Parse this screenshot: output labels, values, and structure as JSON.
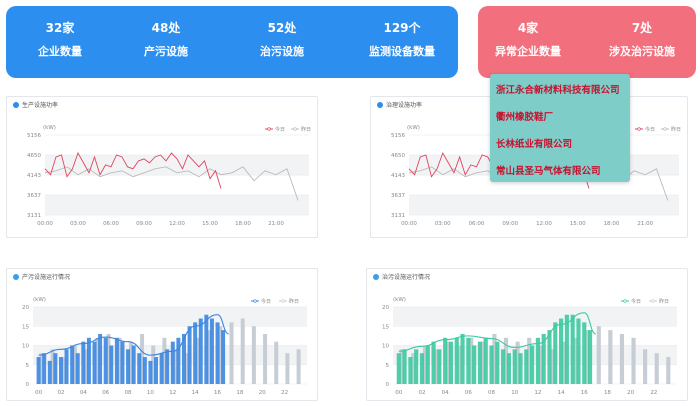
{
  "summary": {
    "items": [
      {
        "value": "32家",
        "label": "企业数量"
      },
      {
        "value": "48处",
        "label": "产污设施"
      },
      {
        "value": "52处",
        "label": "治污设施"
      },
      {
        "value": "129个",
        "label": "监测设备数量"
      }
    ]
  },
  "alerts": {
    "items": [
      {
        "value": "4家",
        "label": "异常企业数量"
      },
      {
        "value": "7处",
        "label": "涉及治污设施"
      }
    ],
    "dropdown": [
      "浙江永合新材料科技有限公司",
      "衢州橡胶鞋厂",
      "长林纸业有限公司",
      "常山县圣马气体有限公司"
    ]
  },
  "colors": {
    "blue": "#2c8ff0",
    "red": "#f2707d",
    "teal": "#7fcdc8",
    "pink": "#e0455f",
    "green": "#3cc9a0"
  },
  "chart_data": [
    {
      "type": "line",
      "title": "生产设施功率",
      "ylabel": "(kW)",
      "yticks": [
        5156,
        4650,
        4143,
        3637,
        3131
      ],
      "ylim": [
        3131,
        5156
      ],
      "xticks": [
        "00:00",
        "03:00",
        "06:00",
        "09:00",
        "12:00",
        "15:00",
        "18:00",
        "21:00"
      ],
      "xlim": [
        0,
        24
      ],
      "series": [
        {
          "name": "今日",
          "color": "#e0455f",
          "x": [
            0,
            0.5,
            1,
            1.5,
            2,
            2.5,
            3,
            3.5,
            4,
            4.5,
            5,
            5.5,
            6,
            6.5,
            7,
            7.5,
            8,
            8.5,
            9,
            9.5,
            10,
            10.5,
            11,
            11.5,
            12,
            12.5,
            13,
            13.5,
            14,
            14.5,
            15,
            15.5,
            16
          ],
          "y": [
            4300,
            4150,
            4600,
            4650,
            4100,
            4300,
            4700,
            4450,
            4200,
            4600,
            4150,
            4400,
            4350,
            4650,
            4600,
            4350,
            4300,
            4500,
            4550,
            4450,
            4600,
            4650,
            4500,
            4700,
            4550,
            4300,
            4650,
            4500,
            4350,
            4500,
            4050,
            4250,
            3800
          ]
        },
        {
          "name": "昨日",
          "color": "#bbbbbb",
          "x": [
            0,
            1,
            2,
            3,
            4,
            5,
            6,
            7,
            8,
            9,
            10,
            11,
            12,
            13,
            14,
            15,
            16,
            17,
            18,
            19,
            20,
            21,
            22,
            23
          ],
          "y": [
            4200,
            4250,
            4350,
            4150,
            4300,
            4100,
            4200,
            4250,
            4100,
            4200,
            4300,
            4350,
            4200,
            4250,
            4100,
            4300,
            4150,
            4200,
            4350,
            4000,
            4250,
            4150,
            4300,
            3500
          ]
        }
      ]
    },
    {
      "type": "line",
      "title": "治理设施功率",
      "ylabel": "(kW)",
      "yticks": [
        5156,
        4650,
        4143,
        3637,
        3131
      ],
      "ylim": [
        3131,
        5156
      ],
      "xticks": [
        "00:00",
        "03:00",
        "06:00",
        "09:00",
        "12:00",
        "15:00",
        "18:00",
        "21:00"
      ],
      "xlim": [
        0,
        24
      ],
      "series": [
        {
          "name": "今日",
          "color": "#e0455f",
          "x": [
            0,
            0.5,
            1,
            1.5,
            2,
            2.5,
            3,
            3.5,
            4,
            4.5,
            5,
            5.5,
            6,
            6.5,
            7,
            7.5,
            8,
            8.5,
            9,
            9.5,
            10,
            10.5,
            11,
            11.5,
            12,
            12.5,
            13,
            13.5,
            14,
            14.5,
            15,
            15.5,
            16
          ],
          "y": [
            4300,
            4150,
            4600,
            4650,
            4100,
            4300,
            4700,
            4450,
            4200,
            4600,
            4150,
            4400,
            4350,
            4650,
            4600,
            4350,
            4300,
            4500,
            4550,
            4450,
            4600,
            4650,
            4500,
            4700,
            4550,
            4300,
            4650,
            4500,
            4350,
            4500,
            4050,
            4250,
            3800
          ]
        },
        {
          "name": "昨日",
          "color": "#bbbbbb",
          "x": [
            0,
            1,
            2,
            3,
            4,
            5,
            6,
            7,
            8,
            9,
            10,
            11,
            12,
            13,
            14,
            15,
            16,
            17,
            18,
            19,
            20,
            21,
            22,
            23
          ],
          "y": [
            4200,
            4250,
            4350,
            4150,
            4300,
            4100,
            4200,
            4250,
            4100,
            4200,
            4300,
            4350,
            4200,
            4250,
            4100,
            4300,
            4150,
            4200,
            4350,
            4000,
            4250,
            4150,
            4300,
            3500
          ]
        }
      ]
    },
    {
      "type": "bar",
      "title": "产污设施运行情况",
      "ylabel": "(kW)",
      "yticks": [
        0,
        5,
        10,
        15,
        20
      ],
      "ylim": [
        0,
        20
      ],
      "xticks": [
        "00",
        "02",
        "04",
        "06",
        "08",
        "10",
        "12",
        "14",
        "16",
        "18",
        "20",
        "22"
      ],
      "series": [
        {
          "name": "今日",
          "color": "#3a86e0",
          "x": [
            0,
            0.5,
            1,
            1.5,
            2,
            2.5,
            3,
            3.5,
            4,
            4.5,
            5,
            5.5,
            6,
            6.5,
            7,
            7.5,
            8,
            8.5,
            9,
            9.5,
            10,
            10.5,
            11,
            11.5,
            12,
            12.5,
            13,
            13.5,
            14,
            14.5,
            15,
            15.5,
            16,
            16.5
          ],
          "y": [
            7,
            8,
            6,
            8,
            7,
            9,
            10,
            8,
            11,
            12,
            11,
            13,
            12,
            10,
            12,
            11,
            9,
            10,
            8,
            7,
            6,
            7,
            8,
            9,
            11,
            12,
            13,
            15,
            16,
            17,
            18,
            17,
            16,
            14
          ]
        },
        {
          "name": "昨日",
          "color": "#c7cdd5",
          "x": [
            0.25,
            1.25,
            2.25,
            3.25,
            4.25,
            5.25,
            6.25,
            7.25,
            8.25,
            9.25,
            10.25,
            11.25,
            12.25,
            13.25,
            14.25,
            15.25,
            16.25,
            17.25,
            18.25,
            19.25,
            20.25,
            21.25,
            22.25,
            23.25
          ],
          "y": [
            8,
            9,
            7,
            10,
            9,
            12,
            13,
            12,
            11,
            13,
            10,
            12,
            9,
            8,
            12,
            14,
            15,
            16,
            17,
            15,
            13,
            11,
            8,
            9
          ]
        }
      ],
      "trend": {
        "x": [
          0,
          2,
          4,
          6,
          8,
          10,
          12,
          14,
          16,
          17
        ],
        "y": [
          7.5,
          9,
          10.5,
          12.2,
          11,
          7.5,
          8.5,
          15,
          18,
          13
        ]
      }
    },
    {
      "type": "bar",
      "title": "治污设施运行情况",
      "ylabel": "(kW)",
      "yticks": [
        0,
        5,
        10,
        15,
        20
      ],
      "ylim": [
        0,
        20
      ],
      "xticks": [
        "00",
        "02",
        "04",
        "06",
        "08",
        "10",
        "12",
        "14",
        "16",
        "18",
        "20",
        "22"
      ],
      "series": [
        {
          "name": "今日",
          "color": "#3cc9a0",
          "x": [
            0,
            0.5,
            1,
            1.5,
            2,
            2.5,
            3,
            3.5,
            4,
            4.5,
            5,
            5.5,
            6,
            6.5,
            7,
            7.5,
            8,
            8.5,
            9,
            9.5,
            10,
            10.5,
            11,
            11.5,
            12,
            12.5,
            13,
            13.5,
            14,
            14.5,
            15,
            15.5,
            16,
            16.5
          ],
          "y": [
            8,
            9,
            7,
            9,
            8,
            10,
            11,
            9,
            12,
            11,
            12,
            13,
            12,
            10,
            11,
            12,
            10,
            11,
            9,
            8,
            9,
            8,
            9,
            10,
            12,
            13,
            14,
            16,
            17,
            18,
            18,
            17,
            16,
            14
          ]
        },
        {
          "name": "昨日",
          "color": "#c7cdd5",
          "x": [
            0.25,
            1.25,
            2.25,
            3.25,
            4.25,
            5.25,
            6.25,
            7.25,
            8.25,
            9.25,
            10.25,
            11.25,
            12.25,
            13.25,
            14.25,
            15.25,
            16.25,
            17.25,
            18.25,
            19.25,
            20.25,
            21.25,
            22.25,
            23.25
          ],
          "y": [
            9,
            8,
            10,
            9,
            11,
            10,
            12,
            11,
            13,
            12,
            11,
            12,
            10,
            9,
            11,
            12,
            14,
            15,
            14,
            13,
            12,
            9,
            8,
            7
          ]
        }
      ],
      "trend": {
        "x": [
          0,
          2,
          4,
          6,
          8,
          10,
          12,
          14,
          16,
          17
        ],
        "y": [
          8.5,
          9.8,
          11.5,
          12.5,
          11.8,
          9.5,
          10.5,
          15.5,
          18.5,
          13
        ]
      }
    }
  ]
}
